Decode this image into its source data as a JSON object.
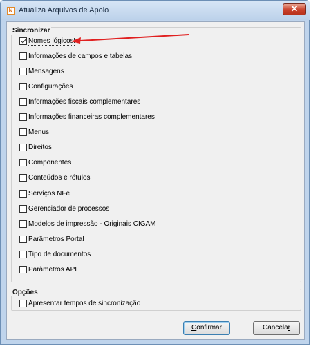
{
  "window": {
    "title": "Atualiza Arquivos de Apoio",
    "close_glyph": "✕",
    "app_icon_glyph": "N"
  },
  "sync_group": {
    "title": "Sincronizar",
    "items": [
      {
        "label": "Nomes lógicos",
        "checked": true
      },
      {
        "label": "Informações de campos e tabelas",
        "checked": false
      },
      {
        "label": "Mensagens",
        "checked": false
      },
      {
        "label": "Configurações",
        "checked": false
      },
      {
        "label": "Informações fiscais complementares",
        "checked": false
      },
      {
        "label": "Informações financeiras complementares",
        "checked": false
      },
      {
        "label": "Menus",
        "checked": false
      },
      {
        "label": "Direitos",
        "checked": false
      },
      {
        "label": "Componentes",
        "checked": false
      },
      {
        "label": "Conteúdos e rótulos",
        "checked": false
      },
      {
        "label": "Serviços NFe",
        "checked": false
      },
      {
        "label": "Gerenciador de processos",
        "checked": false
      },
      {
        "label": "Modelos de impressão - Originais CIGAM",
        "checked": false
      },
      {
        "label": "Parâmetros Portal",
        "checked": false
      },
      {
        "label": "Tipo de documentos",
        "checked": false
      },
      {
        "label": "Parâmetros API",
        "checked": false
      }
    ]
  },
  "options_group": {
    "title": "Opções",
    "items": [
      {
        "label": "Apresentar tempos de sincronização",
        "checked": false
      }
    ]
  },
  "buttons": {
    "confirm_prefix": "",
    "confirm_mnemonic": "C",
    "confirm_rest": "onfirmar",
    "cancel_prefix": "Cancela",
    "cancel_mnemonic": "r",
    "cancel_rest": ""
  },
  "annotation": {
    "arrow_color": "#e02020"
  }
}
